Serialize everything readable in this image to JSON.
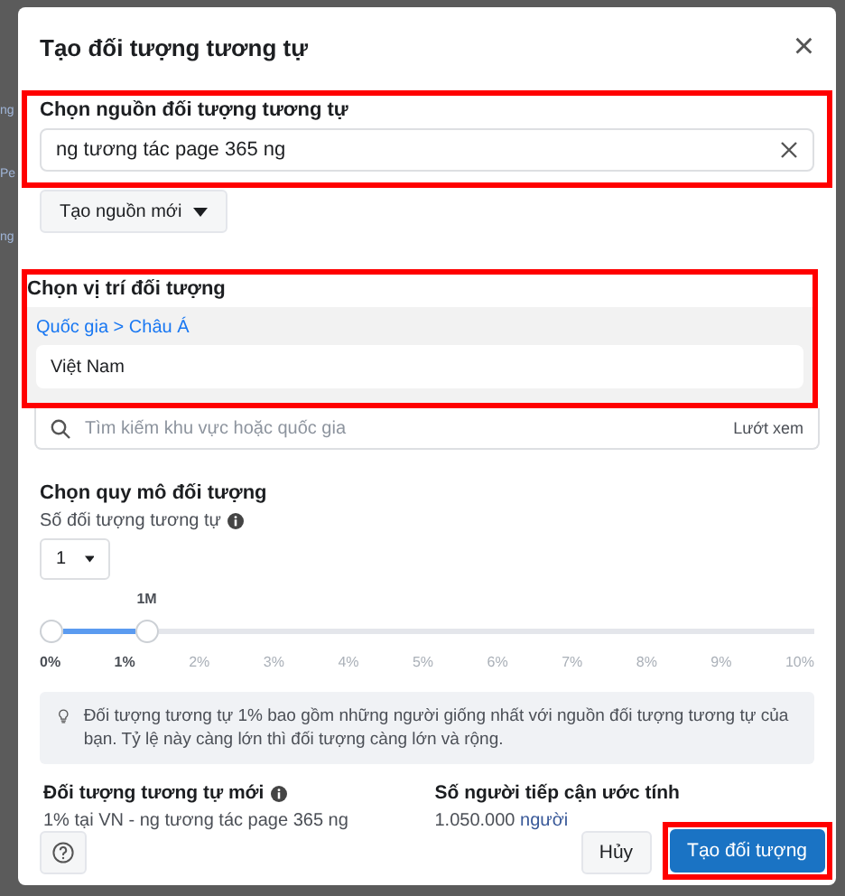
{
  "background_fragments": [
    "ng",
    "Pe",
    "ng"
  ],
  "dialog": {
    "title": "Tạo đối tượng tương tự",
    "close": "×"
  },
  "source": {
    "highlighted": true,
    "label": "Chọn nguồn đối tượng tương tự",
    "value": "ng tương tác page 365 ng",
    "create_button": "Tạo nguồn mới"
  },
  "location": {
    "highlighted": true,
    "label": "Chọn vị trí đối tượng",
    "breadcrumb": [
      "Quốc gia",
      "Châu Á"
    ],
    "separator": ">",
    "selected_items": [
      "Việt Nam"
    ],
    "search_placeholder": "Tìm kiếm khu vực hoặc quốc gia",
    "browse": "Lướt xem"
  },
  "size": {
    "label": "Chọn quy mô đối tượng",
    "count_label": "Số đối tượng tương tự",
    "count_value": "1",
    "slider_label": "1M",
    "ticks": [
      {
        "label": "0%",
        "active": true
      },
      {
        "label": "1%",
        "active": true
      },
      {
        "label": "2%",
        "active": false
      },
      {
        "label": "3%",
        "active": false
      },
      {
        "label": "4%",
        "active": false
      },
      {
        "label": "5%",
        "active": false
      },
      {
        "label": "6%",
        "active": false
      },
      {
        "label": "7%",
        "active": false
      },
      {
        "label": "8%",
        "active": false
      },
      {
        "label": "9%",
        "active": false
      },
      {
        "label": "10%",
        "active": false
      }
    ]
  },
  "info": "Đối tượng tương tự 1% bao gồm những người giống nhất với nguồn đối tượng tương tự của bạn. Tỷ lệ này càng lớn thì đối tượng càng lớn và rộng.",
  "result": {
    "new_label": "Đối tượng tương tự mới",
    "new_value": "1% tại VN - ng tương tác page 365 ng",
    "reach_label": "Số người tiếp cận ước tính",
    "reach_value": "1.050.000",
    "reach_unit": "người"
  },
  "footer": {
    "cancel": "Hủy",
    "create": "Tạo đối tượng",
    "create_highlighted": true
  }
}
